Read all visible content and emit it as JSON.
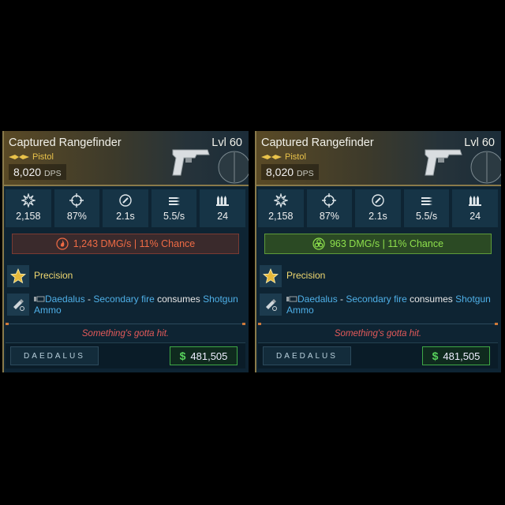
{
  "colors": {
    "fire": "#ef6b45",
    "corrosive": "#8ee04c",
    "rarity": "#e9c24a",
    "perk": "#f0d870",
    "keyword": "#4fb0e8",
    "flavor": "#e45a5a",
    "money": "#58d25c"
  },
  "cards": [
    {
      "name": "Captured Rangefinder",
      "level": "Lvl 60",
      "type": "Pistol",
      "dps": "8,020",
      "dps_unit": "DPS",
      "stats": {
        "damage": "2,158",
        "accuracy": "87%",
        "reload": "2.1s",
        "fire_rate": "5.5/s",
        "magazine": "24"
      },
      "element": {
        "kind": "fire",
        "icon": "fire-icon",
        "text": "1,243 DMG/s | 11% Chance"
      },
      "perk_name": "Precision",
      "ability": {
        "source": "Daedalus",
        "dash": " - ",
        "keyword": "Secondary fire",
        "middle": " consumes ",
        "ammo": "Shotgun Ammo"
      },
      "flavor": "Something's gotta hit.",
      "manufacturer": "DAEDALUS",
      "price": "481,505",
      "currency": "$"
    },
    {
      "name": "Captured Rangefinder",
      "level": "Lvl 60",
      "type": "Pistol",
      "dps": "8,020",
      "dps_unit": "DPS",
      "stats": {
        "damage": "2,158",
        "accuracy": "87%",
        "reload": "2.1s",
        "fire_rate": "5.5/s",
        "magazine": "24"
      },
      "element": {
        "kind": "corrosive",
        "icon": "biohazard-icon",
        "text": "963 DMG/s | 11% Chance"
      },
      "perk_name": "Precision",
      "ability": {
        "source": "Daedalus",
        "dash": " - ",
        "keyword": "Secondary fire",
        "middle": " consumes ",
        "ammo": "Shotgun Ammo"
      },
      "flavor": "Something's gotta hit.",
      "manufacturer": "DAEDALUS",
      "price": "481,505",
      "currency": "$"
    }
  ]
}
